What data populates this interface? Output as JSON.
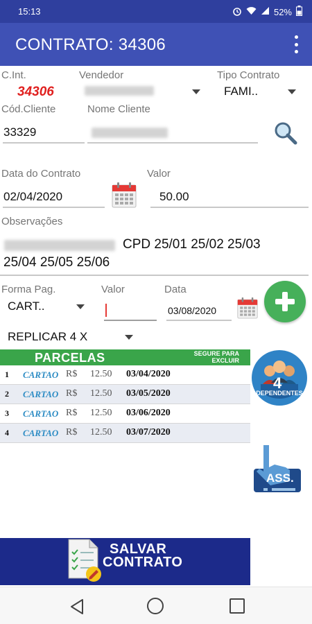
{
  "status": {
    "time": "15:13",
    "battery": "52%"
  },
  "appbar": {
    "title": "CONTRATO: 34306"
  },
  "form": {
    "cint_label": "C.Int.",
    "cint_value": "34306",
    "vendedor_label": "Vendedor",
    "tipo_label": "Tipo Contrato",
    "tipo_value": "FAMI..",
    "cod_label": "Cód.Cliente",
    "cod_value": "33329",
    "nome_label": "Nome Cliente",
    "data_label": "Data do Contrato",
    "data_value": "02/04/2020",
    "valor_label": "Valor",
    "valor_value": "50.00",
    "obs_label": "Observações",
    "obs_value_line1": "CPD 25/01 25/02 25/03",
    "obs_value_line2": "25/04 25/05 25/06",
    "forma_label": "Forma Pag.",
    "forma_value": "CART..",
    "valor2_label": "Valor",
    "data2_label": "Data",
    "data2_value": "03/08/2020",
    "replicar_value": "REPLICAR 4 X"
  },
  "parcelas": {
    "title": "PARCELAS",
    "hint_line1": "SEGURE PARA",
    "hint_line2": "EXCLUIR",
    "rows": [
      {
        "n": "1",
        "payment": "CARTAO",
        "currency": "R$",
        "amount": "12.50",
        "date": "03/04/2020"
      },
      {
        "n": "2",
        "payment": "CARTAO",
        "currency": "R$",
        "amount": "12.50",
        "date": "03/05/2020"
      },
      {
        "n": "3",
        "payment": "CARTAO",
        "currency": "R$",
        "amount": "12.50",
        "date": "03/06/2020"
      },
      {
        "n": "4",
        "payment": "CARTAO",
        "currency": "R$",
        "amount": "12.50",
        "date": "03/07/2020"
      }
    ]
  },
  "dependentes": {
    "count": "4",
    "label": "DEPENDENTES"
  },
  "assinatura": {
    "label": "ASS."
  },
  "save": {
    "line1": "SALVAR",
    "line2": "CONTRATO"
  },
  "colors": {
    "appbar": "#3f51b5",
    "statusbar": "#2f3f9e",
    "accent_green": "#3aa54a",
    "cint_red": "#e0201f",
    "save_bar": "#1c2a8a"
  }
}
